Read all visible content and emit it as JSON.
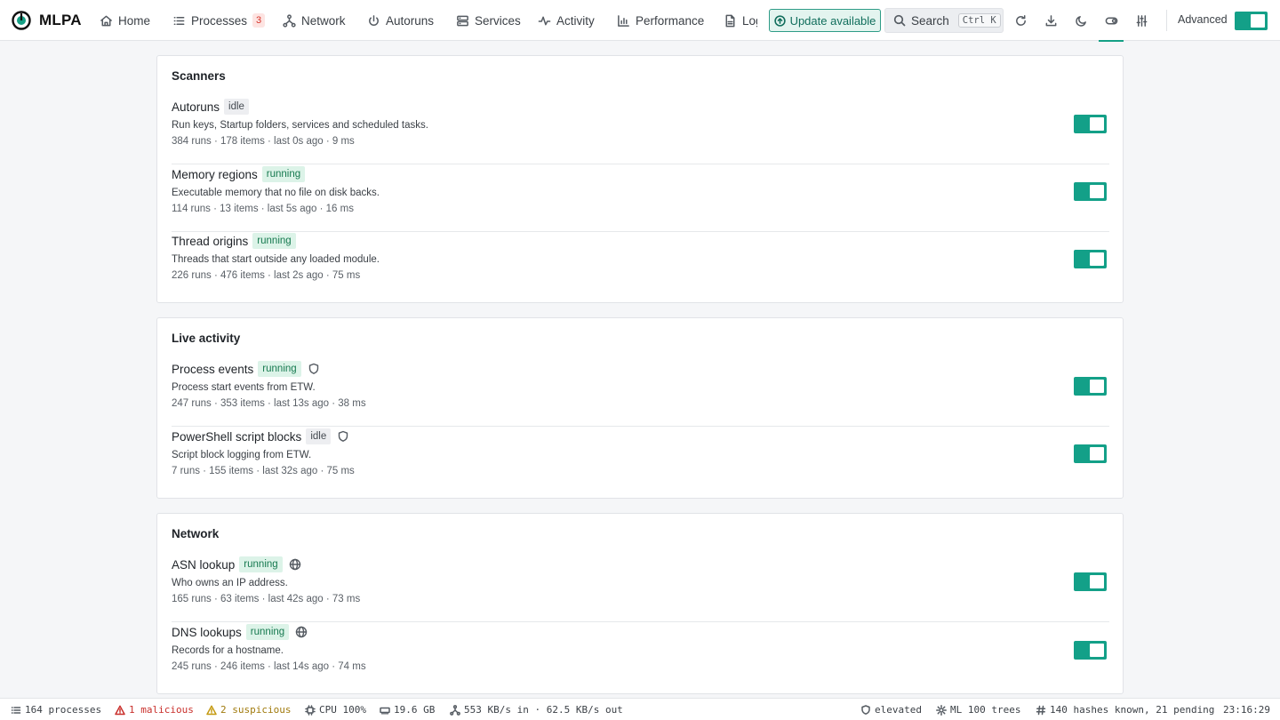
{
  "app": {
    "name": "MLPA"
  },
  "nav": [
    {
      "id": "home",
      "label": "Home",
      "icon": "home-icon"
    },
    {
      "id": "processes",
      "label": "Processes",
      "icon": "list-icon",
      "badge": "3"
    },
    {
      "id": "network",
      "label": "Network",
      "icon": "network-icon"
    },
    {
      "id": "autoruns",
      "label": "Autoruns",
      "icon": "power-icon"
    },
    {
      "id": "services",
      "label": "Services",
      "icon": "server-icon"
    },
    {
      "id": "activity",
      "label": "Activity",
      "icon": "activity-icon"
    },
    {
      "id": "performance",
      "label": "Performance",
      "icon": "bar-chart-icon"
    },
    {
      "id": "log",
      "label": "Log",
      "icon": "document-icon"
    }
  ],
  "update_label": "Update available",
  "search": {
    "label": "Search",
    "shortcut": "Ctrl K"
  },
  "toolbar_icons": [
    "refresh-icon",
    "download-icon",
    "moon-icon",
    "toggle-icon",
    "sliders-icon"
  ],
  "advanced": {
    "label": "Advanced",
    "on": true
  },
  "sections": [
    {
      "title": "Scanners",
      "rows": [
        {
          "name": "Autoruns",
          "status": "idle",
          "desc": "Run keys, Startup folders, services and scheduled tasks.",
          "meta": "384 runs · 178 items · last 0s ago · 9 ms",
          "enabled": true
        },
        {
          "name": "Memory regions",
          "status": "running",
          "desc": "Executable memory that no file on disk backs.",
          "meta": "114 runs · 13 items · last 5s ago · 16 ms",
          "enabled": true
        },
        {
          "name": "Thread origins",
          "status": "running",
          "desc": "Threads that start outside any loaded module.",
          "meta": "226 runs · 476 items · last 2s ago · 75 ms",
          "enabled": true
        }
      ]
    },
    {
      "title": "Live activity",
      "rows": [
        {
          "name": "Process events",
          "status": "running",
          "icon": "shield-icon",
          "desc": "Process start events from ETW.",
          "meta": "247 runs · 353 items · last 13s ago · 38 ms",
          "enabled": true
        },
        {
          "name": "PowerShell script blocks",
          "status": "idle",
          "icon": "shield-icon",
          "desc": "Script block logging from ETW.",
          "meta": "7 runs · 155 items · last 32s ago · 75 ms",
          "enabled": true
        }
      ]
    },
    {
      "title": "Network",
      "rows": [
        {
          "name": "ASN lookup",
          "status": "running",
          "icon": "globe-icon",
          "desc": "Who owns an IP address.",
          "meta": "165 runs · 63 items · last 42s ago · 73 ms",
          "enabled": true
        },
        {
          "name": "DNS lookups",
          "status": "running",
          "icon": "globe-icon",
          "desc": "Records for a hostname.",
          "meta": "245 runs · 246 items · last 14s ago · 74 ms",
          "enabled": true
        }
      ]
    }
  ],
  "statusbar": {
    "processes": "164 processes",
    "malicious": "1 malicious",
    "suspicious": "2 suspicious",
    "cpu": "CPU 100%",
    "memory": "19.6 GB",
    "net": "553 KB/s in · 62.5 KB/s out",
    "elevated": "elevated",
    "ml": "ML 100 trees",
    "hashes": "140 hashes known, 21 pending",
    "clock": "23:16:29"
  },
  "colors": {
    "accent": "#13a088",
    "danger": "#c9302c",
    "warning": "#c49a12"
  }
}
